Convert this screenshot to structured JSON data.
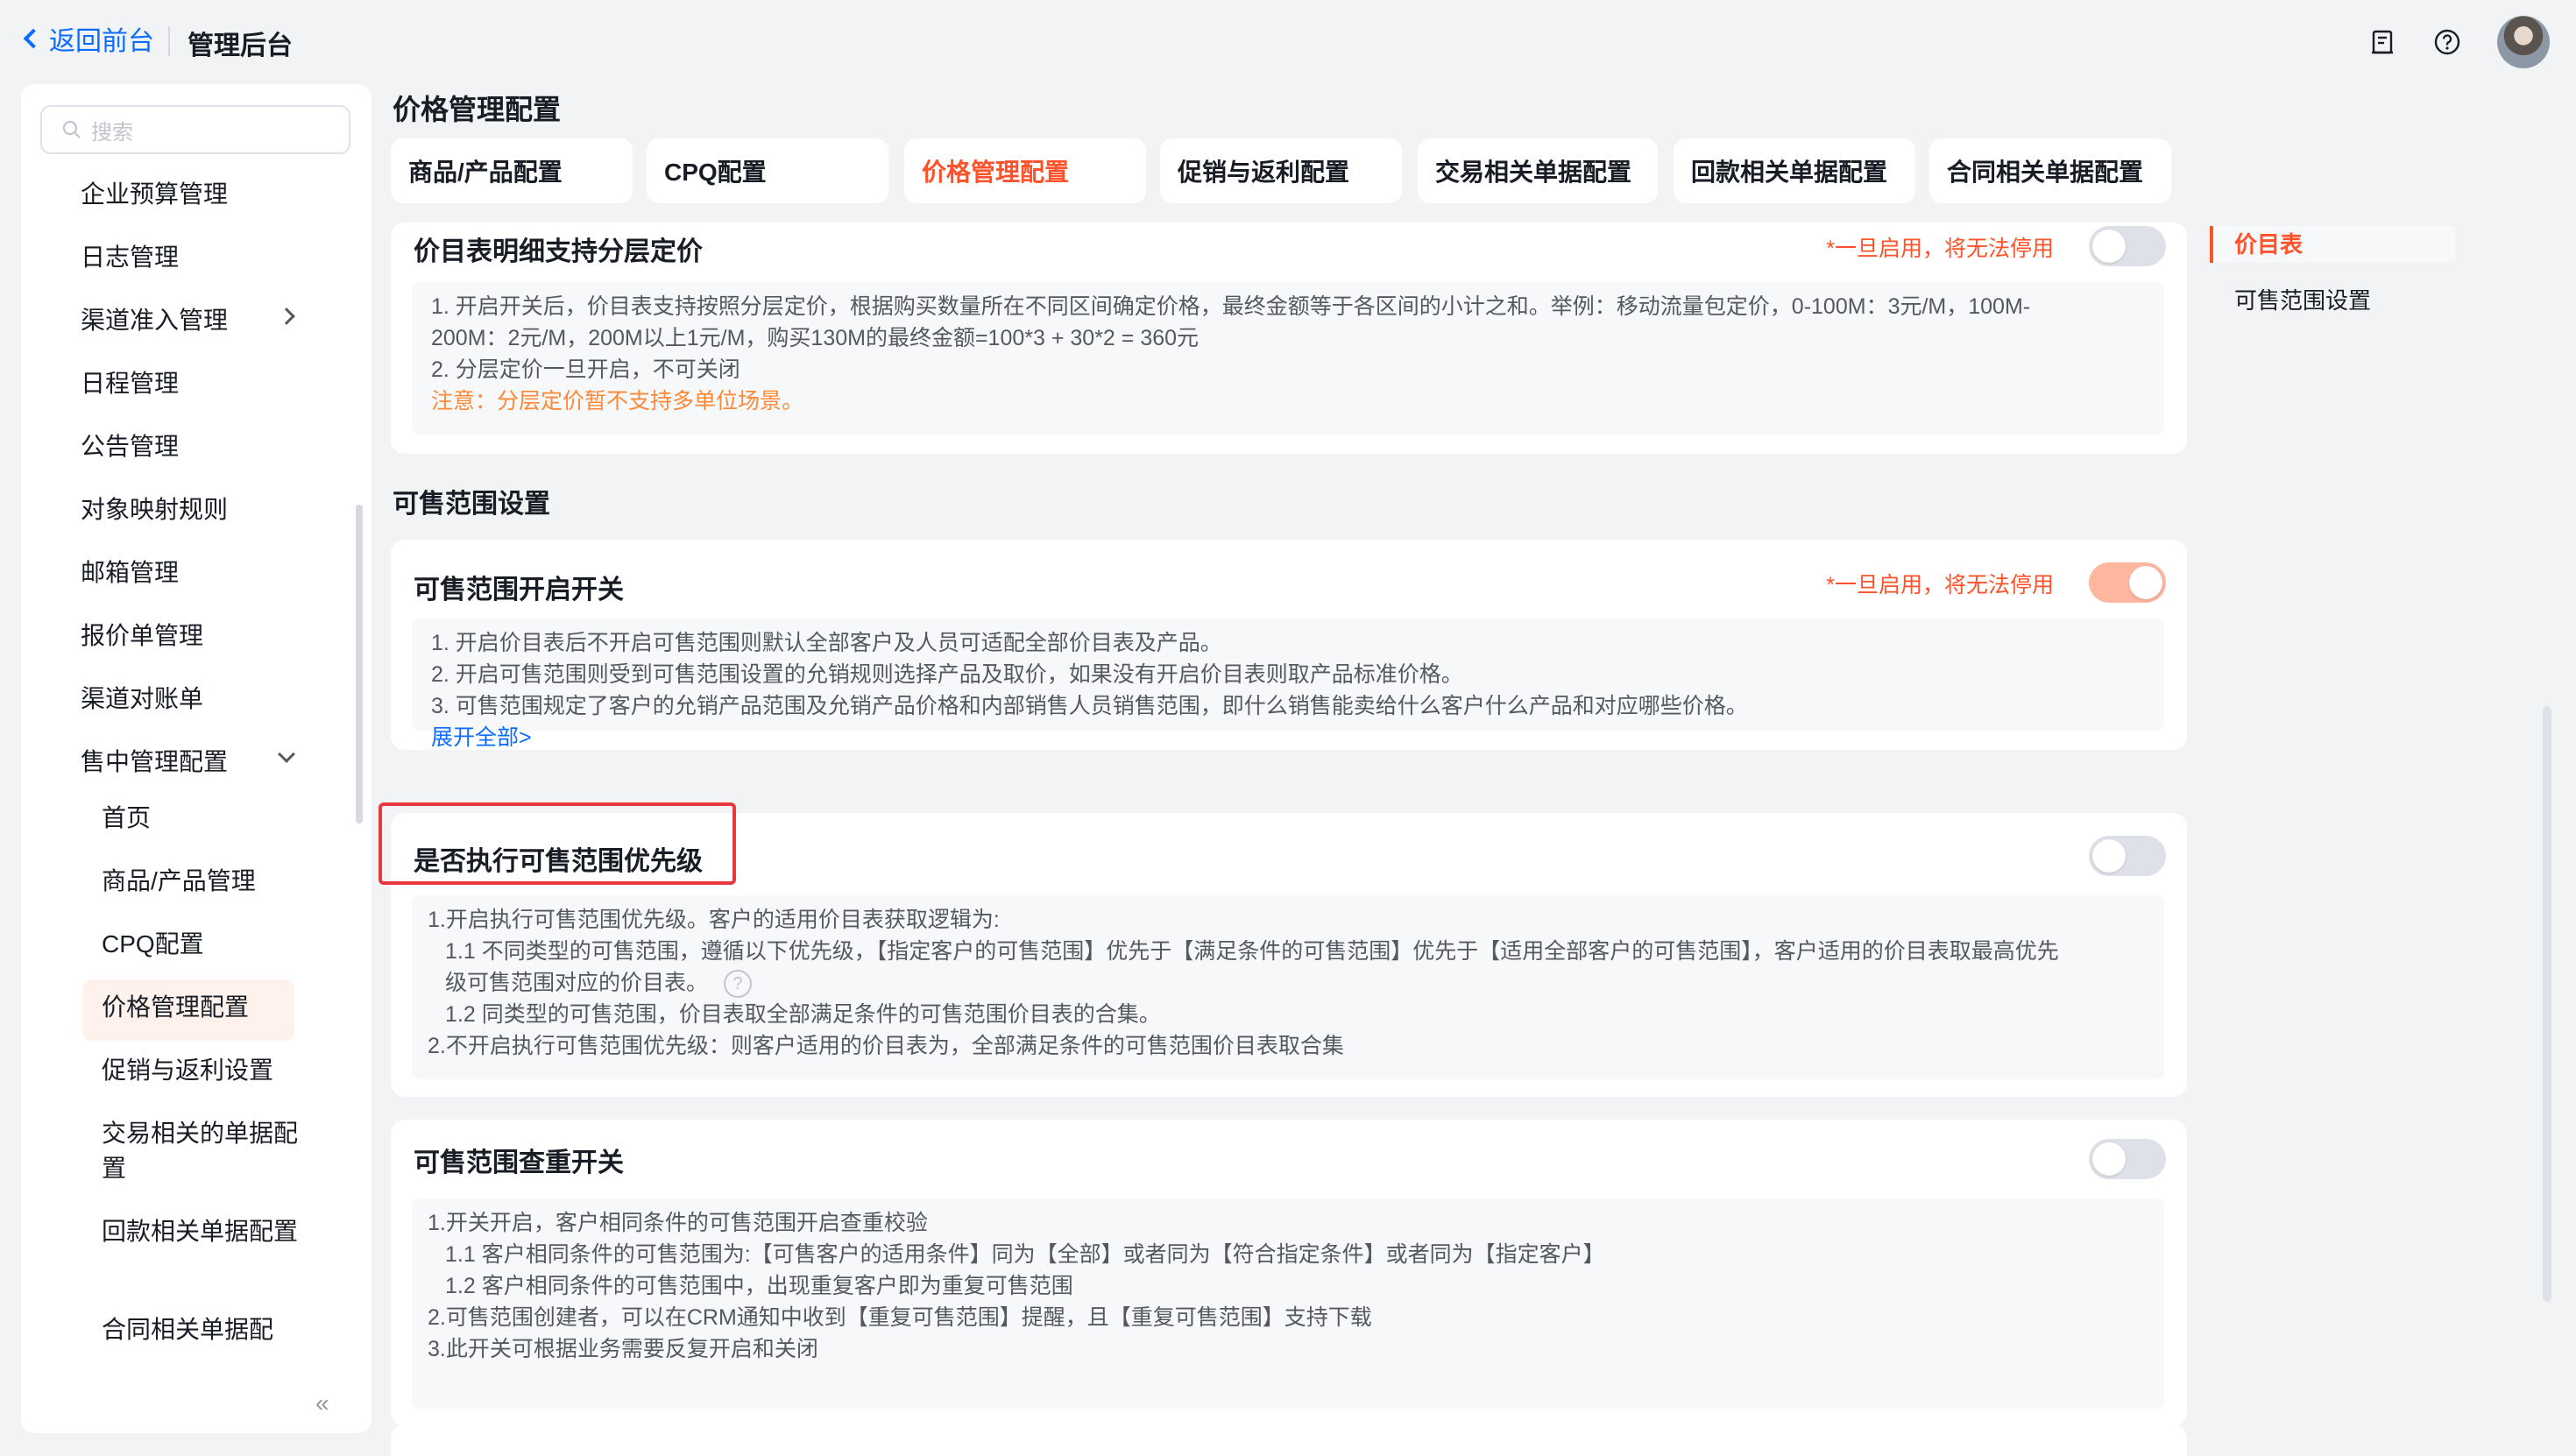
{
  "header": {
    "back_label": "返回前台",
    "admin_title": "管理后台"
  },
  "sidebar": {
    "search_placeholder": "搜索",
    "items": [
      {
        "label": "企业预算管理"
      },
      {
        "label": "日志管理"
      },
      {
        "label": "渠道准入管理"
      },
      {
        "label": "日程管理"
      },
      {
        "label": "公告管理"
      },
      {
        "label": "对象映射规则"
      },
      {
        "label": "邮箱管理"
      },
      {
        "label": "报价单管理"
      },
      {
        "label": "渠道对账单"
      },
      {
        "label": "售中管理配置"
      }
    ],
    "sub_items": [
      {
        "label": "首页"
      },
      {
        "label": "商品/产品管理"
      },
      {
        "label": "CPQ配置"
      },
      {
        "label": "价格管理配置"
      },
      {
        "label": "促销与返利设置"
      },
      {
        "label": "交易相关的单据配置"
      },
      {
        "label": "回款相关单据配置"
      },
      {
        "label": "合同相关单据配"
      }
    ],
    "collapse_label": "«"
  },
  "main": {
    "page_title": "价格管理配置",
    "tabs": [
      {
        "label": "商品/产品配置"
      },
      {
        "label": "CPQ配置"
      },
      {
        "label": "价格管理配置"
      },
      {
        "label": "促销与返利配置"
      },
      {
        "label": "交易相关单据配置"
      },
      {
        "label": "回款相关单据配置"
      },
      {
        "label": "合同相关单据配置"
      }
    ],
    "active_tab": "价格管理配置",
    "section_title": "可售范围设置",
    "cards": {
      "tiered": {
        "title": "价目表明细支持分层定价",
        "warning": "*一旦启用，将无法停用",
        "toggle_on": false,
        "lines": [
          "1. 开启开关后，价目表支持按照分层定价，根据购买数量所在不同区间确定价格，最终金额等于各区间的小计之和。举例：移动流量包定价，0-100M：3元/M，100M-",
          "200M：2元/M，200M以上1元/M，购买130M的最终金额=100*3 + 30*2 = 360元",
          "2. 分层定价一旦开启，不可关闭",
          "注意：分层定价暂不支持多单位场景。"
        ]
      },
      "saleable": {
        "title": "可售范围开启开关",
        "warning": "*一旦启用，将无法停用",
        "toggle_on": true,
        "lines": [
          "1. 开启价目表后不开启可售范围则默认全部客户及人员可适配全部价目表及产品。",
          "2. 开启可售范围则受到可售范围设置的允销规则选择产品及取价，如果没有开启价目表则取产品标准价格。",
          "3. 可售范围规定了客户的允销产品范围及允销产品价格和内部销售人员销售范围，即什么销售能卖给什么客户什么产品和对应哪些价格。"
        ],
        "expand_label": "展开全部>"
      },
      "priority": {
        "title": "是否执行可售范围优先级",
        "toggle_on": false,
        "lines": [
          "1.开启执行可售范围优先级。客户的适用价目表获取逻辑为:",
          "1.1 不同类型的可售范围，遵循以下优先级，【指定客户的可售范围】优先于【满足条件的可售范围】优先于【适用全部客户的可售范围】，客户适用的价目表取最高优先",
          "级可售范围对应的价目表。",
          "1.2 同类型的可售范围，价目表取全部满足条件的可售范围价目表的合集。",
          "2.不开启执行可售范围优先级：则客户适用的价目表为，全部满足条件的可售范围价目表取合集"
        ]
      },
      "dedupe": {
        "title": "可售范围查重开关",
        "toggle_on": false,
        "lines": [
          "1.开关开启，客户相同条件的可售范围开启查重校验",
          "1.1 客户相同条件的可售范围为:【可售客户的适用条件】同为【全部】或者同为【符合指定条件】或者同为【指定客户】",
          "1.2 客户相同条件的可售范围中，出现重复客户即为重复可售范围",
          "2.可售范围创建者，可以在CRM通知中收到【重复可售范围】提醒，且【重复可售范围】支持下载",
          "3.此开关可根据业务需要反复开启和关闭"
        ]
      }
    }
  },
  "anchor_nav": {
    "items": [
      {
        "label": "价目表"
      },
      {
        "label": "可售范围设置"
      }
    ]
  },
  "colors": {
    "accent": "#ff522a",
    "link": "#0c6cff",
    "note": "#ff8837",
    "highlight_border": "#e8383d"
  }
}
